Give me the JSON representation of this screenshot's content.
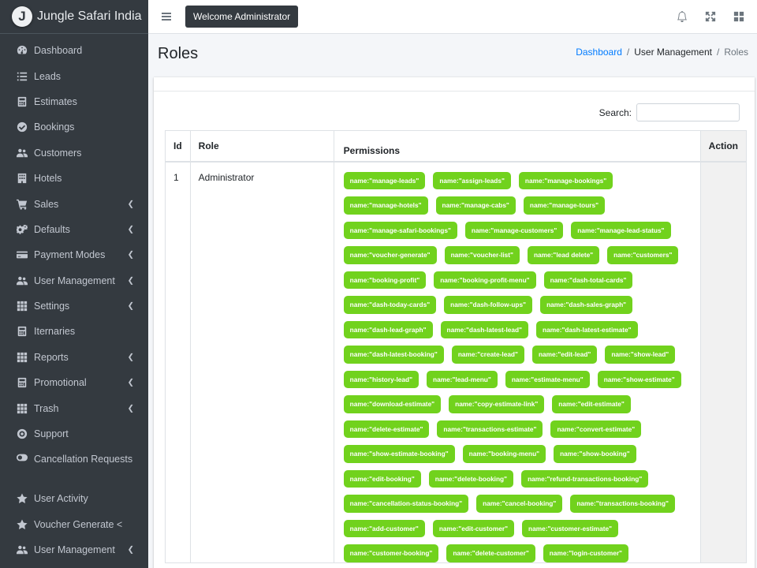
{
  "brand": {
    "logo_letter": "J",
    "name": "Jungle Safari India"
  },
  "sidebar": {
    "items": [
      {
        "label": "Dashboard",
        "icon": "dashboard-icon",
        "chevron": false
      },
      {
        "label": "Leads",
        "icon": "list-icon",
        "chevron": false
      },
      {
        "label": "Estimates",
        "icon": "calculator-icon",
        "chevron": false
      },
      {
        "label": "Bookings",
        "icon": "check-circle-icon",
        "chevron": false
      },
      {
        "label": "Customers",
        "icon": "users-icon",
        "chevron": false
      },
      {
        "label": "Hotels",
        "icon": "building-icon",
        "chevron": false
      },
      {
        "label": "Sales",
        "icon": "cart-icon",
        "chevron": true
      },
      {
        "label": "Defaults",
        "icon": "cogs-icon",
        "chevron": true
      },
      {
        "label": "Payment Modes",
        "icon": "credit-card-icon",
        "chevron": true
      },
      {
        "label": "User Management",
        "icon": "users-icon",
        "chevron": true
      },
      {
        "label": "Settings",
        "icon": "grid-icon",
        "chevron": true
      },
      {
        "label": "Iternaries",
        "icon": "calculator-icon",
        "chevron": false
      },
      {
        "label": "Reports",
        "icon": "grid-icon",
        "chevron": true
      },
      {
        "label": "Promotional",
        "icon": "calculator-icon",
        "chevron": true
      },
      {
        "label": "Trash",
        "icon": "grid-icon",
        "chevron": true
      },
      {
        "label": "Support",
        "icon": "support-icon",
        "chevron": false
      },
      {
        "label": "Cancellation Requests",
        "icon": "toggle-icon",
        "chevron": false
      },
      {
        "label": "User Activity",
        "icon": "star-icon",
        "chevron": false
      },
      {
        "label": "Voucher Generate <",
        "icon": "star-icon",
        "chevron": false
      },
      {
        "label": "User Management",
        "icon": "users-icon",
        "chevron": true
      }
    ]
  },
  "topbar": {
    "welcome": "Welcome Administrator",
    "icons": [
      "bell-icon",
      "expand-icon",
      "apps-icon"
    ]
  },
  "header": {
    "title": "Roles",
    "breadcrumb": {
      "home": "Dashboard",
      "section": "User Management",
      "current": "Roles"
    }
  },
  "search": {
    "label": "Search:",
    "value": "",
    "placeholder": ""
  },
  "table": {
    "headers": [
      "Id",
      "Role",
      "Permissions",
      "Action"
    ],
    "rows": [
      {
        "id": "1",
        "role": "Administrator",
        "permissions": [
          "name:\"manage-leads\"",
          "name:\"assign-leads\"",
          "name:\"manage-bookings\"",
          "name:\"manage-hotels\"",
          "name:\"manage-cabs\"",
          "name:\"manage-tours\"",
          "name:\"manage-safari-bookings\"",
          "name:\"manage-customers\"",
          "name:\"manage-lead-status\"",
          "name:\"voucher-generate\"",
          "name:\"voucher-list\"",
          "name:\"lead delete\"",
          "name:\"customers\"",
          "name:\"booking-profit\"",
          "name:\"booking-profit-menu\"",
          "name:\"dash-total-cards\"",
          "name:\"dash-today-cards\"",
          "name:\"dash-follow-ups\"",
          "name:\"dash-sales-graph\"",
          "name:\"dash-lead-graph\"",
          "name:\"dash-latest-lead\"",
          "name:\"dash-latest-estimate\"",
          "name:\"dash-latest-booking\"",
          "name:\"create-lead\"",
          "name:\"edit-lead\"",
          "name:\"show-lead\"",
          "name:\"history-lead\"",
          "name:\"lead-menu\"",
          "name:\"estimate-menu\"",
          "name:\"show-estimate\"",
          "name:\"download-estimate\"",
          "name:\"copy-estimate-link\"",
          "name:\"edit-estimate\"",
          "name:\"delete-estimate\"",
          "name:\"transactions-estimate\"",
          "name:\"convert-estimate\"",
          "name:\"show-estimate-booking\"",
          "name:\"booking-menu\"",
          "name:\"show-booking\"",
          "name:\"edit-booking\"",
          "name:\"delete-booking\"",
          "name:\"refund-transactions-booking\"",
          "name:\"cancellation-status-booking\"",
          "name:\"cancel-booking\"",
          "name:\"transactions-booking\"",
          "name:\"add-customer\"",
          "name:\"edit-customer\"",
          "name:\"customer-estimate\"",
          "name:\"customer-booking\"",
          "name:\"delete-customer\"",
          "name:\"login-customer\""
        ]
      }
    ]
  },
  "colors": {
    "sidebar": "#343a40",
    "tag": "#71d21d",
    "link": "#007bff"
  }
}
